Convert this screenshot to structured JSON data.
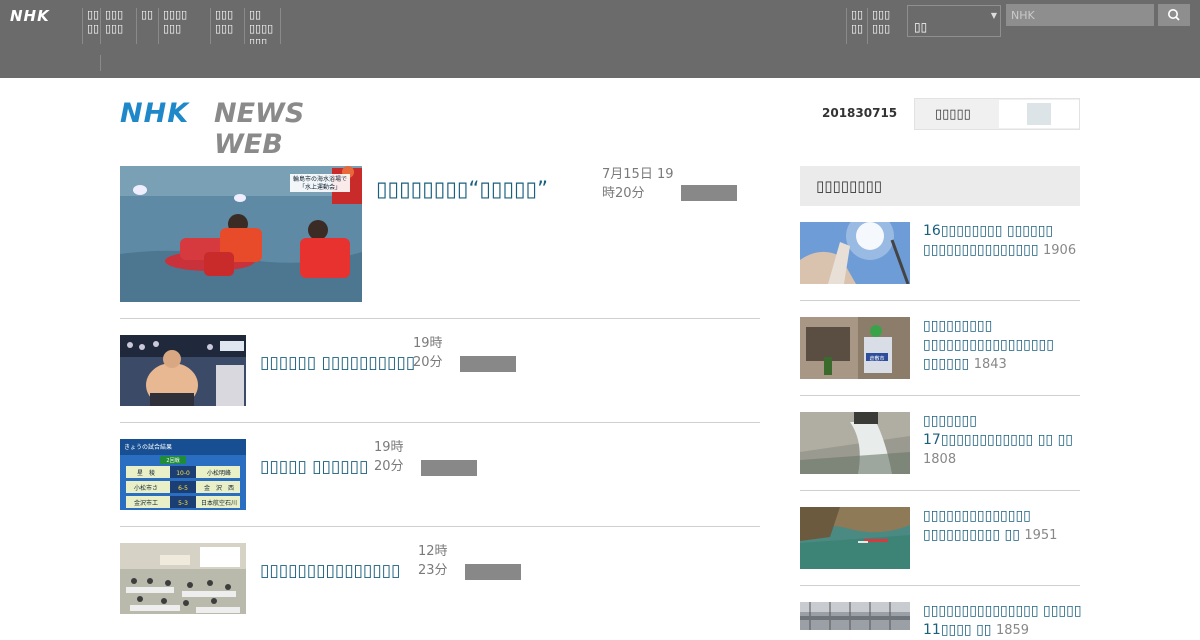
{
  "topbar": {
    "logo": "NHK",
    "nav": [
      {
        "label": "▯▯\n▯▯"
      },
      {
        "label": "▯▯▯\n▯▯▯"
      },
      {
        "label": "▯▯"
      },
      {
        "label": "▯▯▯▯\n▯▯▯"
      },
      {
        "label": "▯▯▯\n▯▯▯"
      },
      {
        "label": "▯▯\n▯▯▯▯\n▯▯▯"
      }
    ],
    "nav_right": [
      {
        "label": "▯▯\n▯▯"
      },
      {
        "label": "▯▯▯\n▯▯▯"
      }
    ],
    "region_value": "▯▯",
    "search_placeholder": "NHK"
  },
  "header": {
    "logo_nhk": "NHK",
    "logo_news": "NEWS WEB",
    "date": "201830715",
    "sns_label": "▯▯▯▯▯"
  },
  "stories": [
    {
      "title": "▯▯▯▯▯▯▯▯“▯▯▯▯▯”",
      "time": "7月15日 19\n時20分"
    },
    {
      "title": "▯▯▯▯▯▯ ▯▯▯▯▯▯▯▯▯▯",
      "time": "19時\n20分"
    },
    {
      "title": "▯▯▯▯▯ ▯▯▯▯▯▯",
      "time": "19時\n20分"
    },
    {
      "title": "▯▯▯▯▯▯▯▯▯▯▯▯▯▯▯",
      "time": "12時\n23分"
    }
  ],
  "ranking": {
    "heading": "▯▯▯▯▯▯▯▯",
    "items": [
      {
        "title": "16▯▯▯▯▯▯▯▯ ▯▯▯▯▯▯ ▯▯▯▯▯▯▯▯▯▯▯▯▯▯▯",
        "count": "1906"
      },
      {
        "title": "▯▯▯▯▯▯▯▯▯ ▯▯▯▯▯▯▯▯▯▯▯▯▯▯▯▯▯ ▯▯▯▯▯▯",
        "count": "1843"
      },
      {
        "title": "▯▯▯▯▯▯▯ 17▯▯▯▯▯▯▯▯▯▯▯▯ ▯▯ ▯▯",
        "count": "1808"
      },
      {
        "title": "▯▯▯▯▯▯▯▯▯▯▯▯▯▯ ▯▯▯▯▯▯▯▯▯▯ ▯▯",
        "count": "1951"
      },
      {
        "title": "▯▯▯▯▯▯▯▯▯▯▯▯▯▯▯ ▯▯▯▯▯ 11▯▯▯▯ ▯▯",
        "count": "1859"
      }
    ]
  },
  "thumb_captions": {
    "story0": [
      "輪島市の海水浴場で",
      "「水上運動会」"
    ],
    "story2_head": "きょうの試合結果",
    "story2_round": "2回戦",
    "story2_rows": [
      {
        "left": "星　稜",
        "score": "10-0",
        "right": "小松明峰"
      },
      {
        "left": "小松市さ",
        "score": "6-5",
        "right": "金　沢　西"
      },
      {
        "left": "金沢市工",
        "score": "5-3",
        "right": "日本航空石川"
      }
    ],
    "rank1_badge": "倉敷市"
  },
  "colors": {
    "topbar": "#6b6b6b",
    "link": "#195f7e",
    "logo_blue": "#1e88c8",
    "tag": "#888888"
  }
}
